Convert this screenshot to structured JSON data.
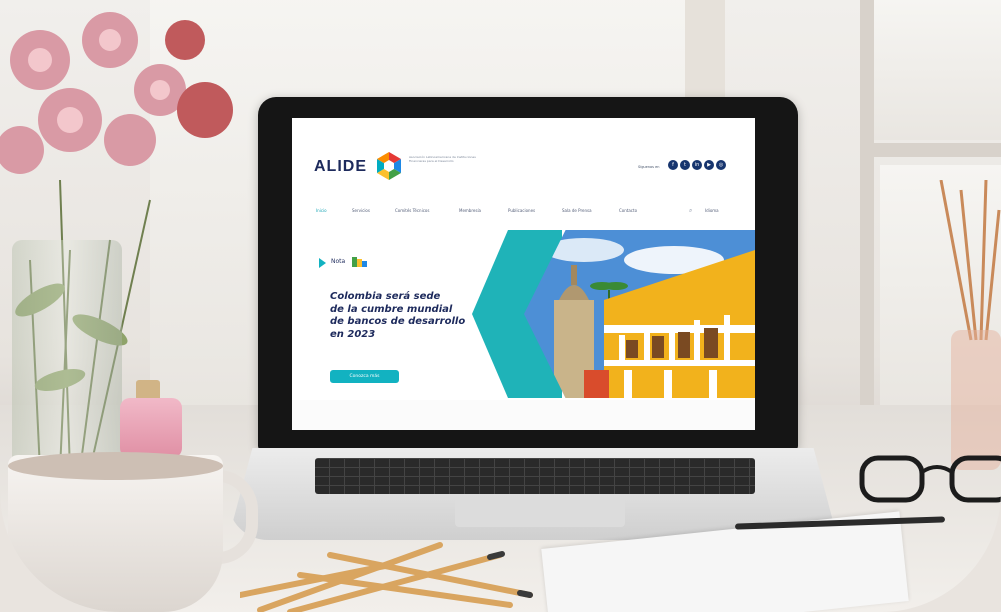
{
  "site": {
    "logo_text": "ALIDE",
    "tagline": "Asociación Latinoamericana de Instituciones Financieras para el Desarrollo",
    "follow_label": "Síguenos en",
    "social_icons": [
      "facebook-icon",
      "twitter-icon",
      "linkedin-icon",
      "youtube-icon",
      "instagram-icon"
    ],
    "nav": [
      {
        "label": "Inicio",
        "active": true
      },
      {
        "label": "Servicios"
      },
      {
        "label": "Comités Técnicos"
      },
      {
        "label": "Membresía"
      },
      {
        "label": "Publicaciones"
      },
      {
        "label": "Sala de Prensa"
      },
      {
        "label": "Contacto"
      }
    ],
    "language": "Idioma",
    "hero": {
      "kicker": "Nota",
      "headline_lines": [
        "Colombia será sede",
        "de la cumbre mundial",
        "de bancos de desarrollo",
        "en 2023"
      ],
      "cta": "Conozca más"
    }
  },
  "colors": {
    "brand_navy": "#1d2a5c",
    "accent_teal": "#12b2c1",
    "facade_yellow": "#f2b21c"
  }
}
